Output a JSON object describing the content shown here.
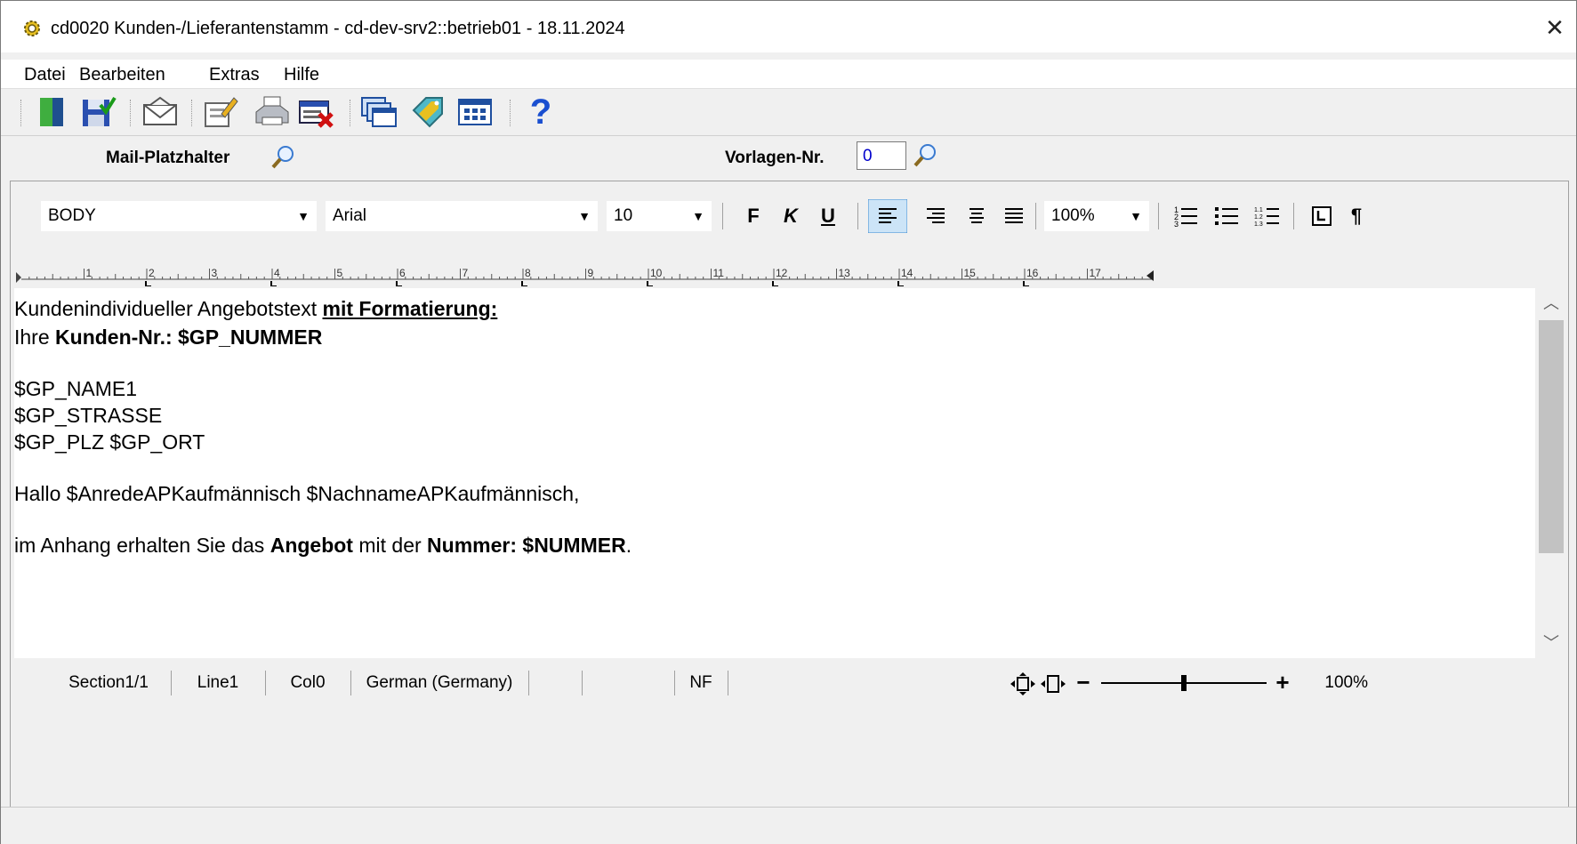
{
  "window": {
    "title": "cd0020 Kunden-/Lieferantenstamm - cd-dev-srv2::betrieb01 - 18.11.2024",
    "close_label": "✕"
  },
  "menu": {
    "items": [
      "Datei",
      "Bearbeiten",
      "Extras",
      "Hilfe"
    ]
  },
  "toolbar": {
    "buttons": [
      "exit-icon",
      "save-icon",
      "mail-icon",
      "edit-icon",
      "print-icon",
      "delete-icon",
      "windows-icon",
      "tag-icon",
      "grid-icon",
      "help-icon"
    ],
    "help_glyph": "?"
  },
  "fields": {
    "mail_placeholder_label": "Mail-Platzhalter",
    "template_number_label": "Vorlagen-Nr.",
    "template_number_value": "0"
  },
  "format_bar": {
    "style": "BODY",
    "font": "Arial",
    "size": "10",
    "bold": "F",
    "italic": "K",
    "underline": "U",
    "zoom": "100%",
    "paragraph_mark": "¶"
  },
  "ruler": {
    "marks": [
      "1",
      "2",
      "3",
      "4",
      "5",
      "6",
      "7",
      "8",
      "9",
      "10",
      "11",
      "12",
      "13",
      "14",
      "15",
      "16",
      "17"
    ]
  },
  "document": {
    "line1_text": "Kundenindividueller Angebotstext ",
    "line1_underline": "mit Formatierung:",
    "line2_text": "Ihre ",
    "line2_bold": "Kunden-Nr.: $GP_NUMMER",
    "line3": "$GP_NAME1",
    "line4": "$GP_STRASSE",
    "line5": "$GP_PLZ $GP_ORT",
    "line6": "Hallo $AnredeAPKaufmännisch $NachnameAPKaufmännisch,",
    "line7_a": "im Anhang erhalten Sie das ",
    "line7_b": "Angebot",
    "line7_c": " mit der ",
    "line7_d": "Nummer: $NUMMER",
    "line7_e": "."
  },
  "statusbar": {
    "section": "Section1/1",
    "line": "Line1",
    "col": "Col0",
    "language": "German (Germany)",
    "empty": "",
    "nf": "NF",
    "zoom_minus": "−",
    "zoom_plus": "+",
    "zoom": "100%",
    "zoom_level": 0.5
  }
}
